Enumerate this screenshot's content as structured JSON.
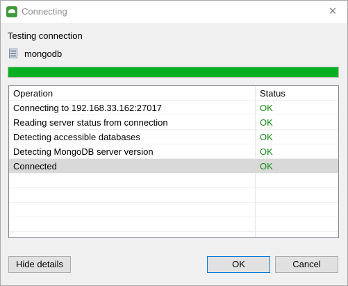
{
  "window": {
    "title": "Connecting",
    "close_glyph": "✕"
  },
  "dialog": {
    "heading": "Testing connection",
    "database": "mongodb",
    "progress_fraction": 1.0,
    "progress_color": "#06b025"
  },
  "table": {
    "headers": {
      "operation": "Operation",
      "status": "Status"
    },
    "rows": [
      {
        "operation": "Connecting to 192.168.33.162:27017",
        "status": "OK"
      },
      {
        "operation": "Reading server status from connection",
        "status": "OK"
      },
      {
        "operation": "Detecting accessible databases",
        "status": "OK"
      },
      {
        "operation": "Detecting MongoDB server version",
        "status": "OK"
      },
      {
        "operation": "Connected",
        "status": "OK",
        "selected": true
      }
    ],
    "status_ok_color": "#168a16"
  },
  "buttons": {
    "hide_details": "Hide details",
    "ok": "OK",
    "cancel": "Cancel"
  },
  "icons": {
    "app": "app-leaf-icon",
    "database": "database-icon",
    "close": "close-icon"
  }
}
